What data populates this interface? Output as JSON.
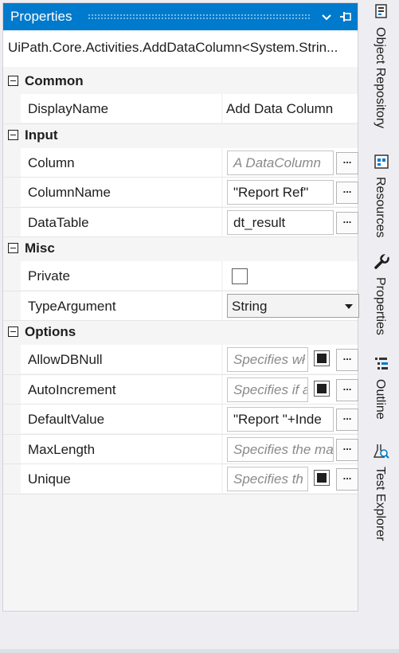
{
  "panel": {
    "title": "Properties",
    "object_name": "UiPath.Core.Activities.AddDataColumn<System.Strin..."
  },
  "categories": [
    {
      "label": "Common",
      "rows": [
        {
          "name": "DisplayName",
          "value": "Add Data Column"
        }
      ]
    },
    {
      "label": "Input",
      "rows": [
        {
          "name": "Column",
          "value": "A DataColumn"
        },
        {
          "name": "ColumnName",
          "value": "\"Report Ref\""
        },
        {
          "name": "DataTable",
          "value": "dt_result"
        }
      ]
    },
    {
      "label": "Misc",
      "rows": [
        {
          "name": "Private",
          "value": ""
        },
        {
          "name": "TypeArgument",
          "value": "String"
        }
      ]
    },
    {
      "label": "Options",
      "rows": [
        {
          "name": "AllowDBNull",
          "value": "Specifies wł"
        },
        {
          "name": "AutoIncrement",
          "value": "Specifies if a"
        },
        {
          "name": "DefaultValue",
          "value": "\"Report \"+Inde"
        },
        {
          "name": "MaxLength",
          "value": "Specifies the ma"
        },
        {
          "name": "Unique",
          "value": "Specifies th"
        }
      ]
    }
  ],
  "ellipsis_label": "...",
  "sidebar": {
    "tabs": [
      {
        "label": "Object Repository",
        "icon": "object-repository-icon"
      },
      {
        "label": "Resources",
        "icon": "resources-icon"
      },
      {
        "label": "Properties",
        "icon": "wrench-icon"
      },
      {
        "label": "Outline",
        "icon": "outline-icon"
      },
      {
        "label": "Test Explorer",
        "icon": "test-explorer-icon"
      }
    ]
  },
  "colors": {
    "accent": "#007acc",
    "panel_background": "#f5f5f5",
    "placeholder_text": "#8a8a8a"
  }
}
